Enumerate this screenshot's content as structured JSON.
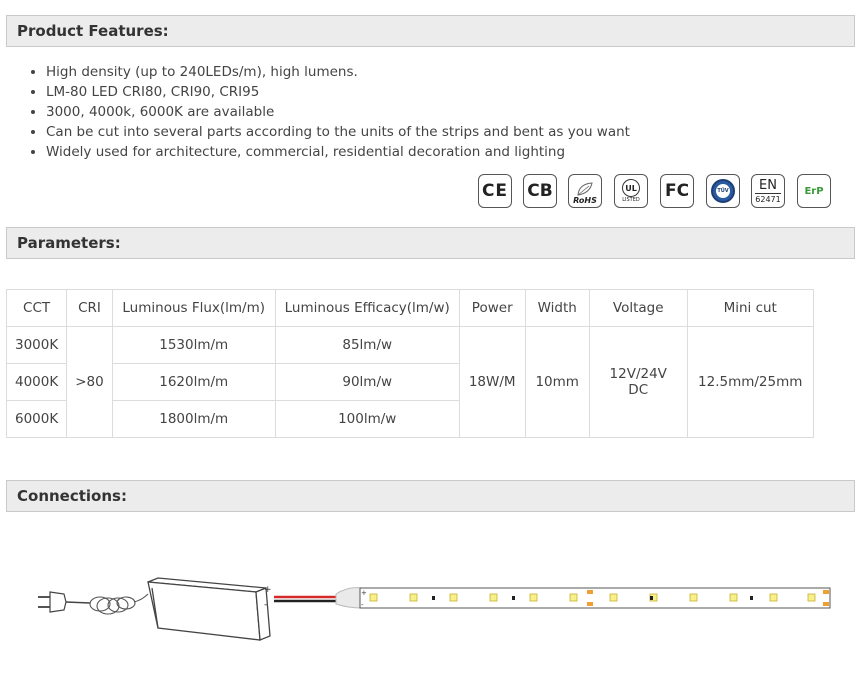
{
  "sections": {
    "features_title": "Product Features:",
    "parameters_title": "Parameters:",
    "connections_title": "Connections:"
  },
  "features": [
    "High density (up to 240LEDs/m), high lumens.",
    "LM-80 LED CRI80, CRI90, CRI95",
    "3000, 4000k, 6000K are available",
    "Can be cut into several parts according to the units of the strips and bent as you want",
    "Widely used for architecture, commercial, residential decoration and lighting"
  ],
  "certifications": {
    "ce": "CE",
    "cb": "CB",
    "rohs": "RoHS",
    "ul": "UL",
    "ul_listed": "LISTED",
    "fc": "FC",
    "tuv": "TÜV",
    "en": "EN",
    "en_code": "62471",
    "erp": "ErP"
  },
  "table": {
    "headers": [
      "CCT",
      "CRI",
      "Luminous Flux(lm/m)",
      "Luminous Efficacy(lm/w)",
      "Power",
      "Width",
      "Voltage",
      "Mini cut"
    ],
    "cct": [
      "3000K",
      "4000K",
      "6000K"
    ],
    "cri": ">80",
    "flux": [
      "1530lm/m",
      "1620lm/m",
      "1800lm/m"
    ],
    "efficacy": [
      "85lm/w",
      "90lm/w",
      "100lm/w"
    ],
    "power": "18W/M",
    "width": "10mm",
    "voltage": "12V/24V DC",
    "mini_cut": "12.5mm/25mm"
  },
  "diagram": {
    "plus": "+",
    "minus": "-"
  }
}
